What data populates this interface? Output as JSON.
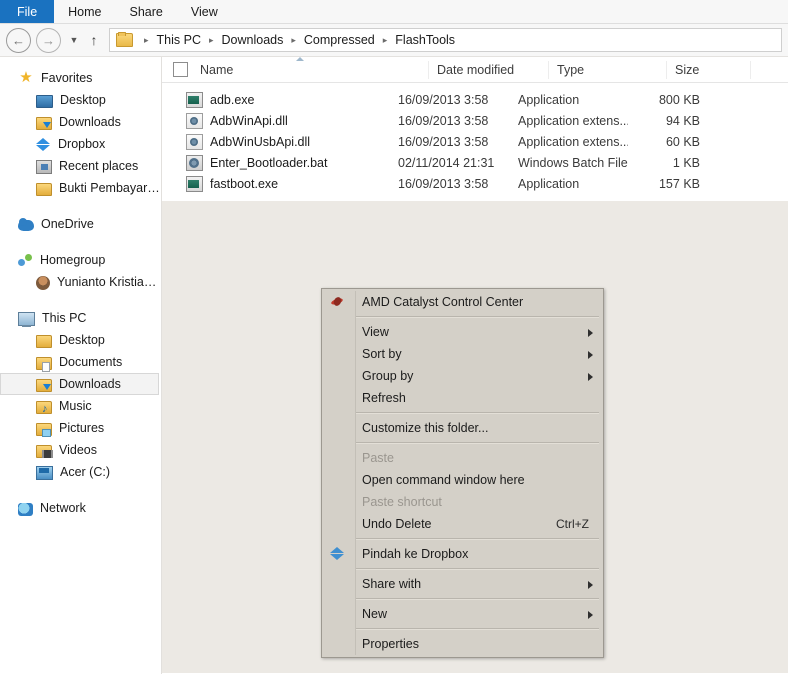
{
  "window": {
    "tabs": [
      {
        "label": "File",
        "active": true
      },
      {
        "label": "Home",
        "active": false
      },
      {
        "label": "Share",
        "active": false
      },
      {
        "label": "View",
        "active": false
      }
    ],
    "accent_color": "#1a72c0",
    "menu_bg_color": "#d4d0c8",
    "content_bg_color": "#ece9e4"
  },
  "nav": {
    "back_icon": "back-arrow-icon",
    "forward_icon": "forward-arrow-icon",
    "history_icon": "chevron-down-icon",
    "up_icon": "up-arrow-icon",
    "folder_icon": "folder-icon",
    "breadcrumbs": [
      "This PC",
      "Downloads",
      "Compressed",
      "FlashTools"
    ],
    "separator": "▸"
  },
  "sidebar": {
    "groups": [
      {
        "header": {
          "label": "Favorites",
          "icon": "star-icon"
        },
        "items": [
          {
            "label": "Desktop",
            "icon": "desktop-icon"
          },
          {
            "label": "Downloads",
            "icon": "downloads-folder-icon"
          },
          {
            "label": "Dropbox",
            "icon": "dropbox-icon"
          },
          {
            "label": "Recent places",
            "icon": "recent-places-icon"
          },
          {
            "label": "Bukti Pembayaran",
            "icon": "folder-icon"
          }
        ]
      },
      {
        "header": {
          "label": "OneDrive",
          "icon": "onedrive-cloud-icon"
        },
        "items": []
      },
      {
        "header": {
          "label": "Homegroup",
          "icon": "homegroup-icon"
        },
        "items": [
          {
            "label": "Yunianto Kristiawan",
            "icon": "user-avatar-icon"
          }
        ]
      },
      {
        "header": {
          "label": "This PC",
          "icon": "this-pc-icon"
        },
        "items": [
          {
            "label": "Desktop",
            "icon": "desktop-folder-icon"
          },
          {
            "label": "Documents",
            "icon": "documents-folder-icon"
          },
          {
            "label": "Downloads",
            "icon": "downloads-folder-icon",
            "selected": true
          },
          {
            "label": "Music",
            "icon": "music-folder-icon"
          },
          {
            "label": "Pictures",
            "icon": "pictures-folder-icon"
          },
          {
            "label": "Videos",
            "icon": "videos-folder-icon"
          },
          {
            "label": "Acer (C:)",
            "icon": "hard-drive-icon"
          }
        ]
      },
      {
        "header": {
          "label": "Network",
          "icon": "network-icon"
        },
        "items": []
      }
    ]
  },
  "filelist": {
    "select_all_checkbox": "select-all-checkbox",
    "sort_indicator": "sort-ascending-icon",
    "columns": [
      "Name",
      "Date modified",
      "Type",
      "Size"
    ],
    "rows": [
      {
        "name": "adb.exe",
        "icon": "exe-file-icon",
        "date": "16/09/2013 3:58",
        "type": "Application",
        "size": "800 KB"
      },
      {
        "name": "AdbWinApi.dll",
        "icon": "dll-file-icon",
        "date": "16/09/2013 3:58",
        "type": "Application extens...",
        "size": "94 KB"
      },
      {
        "name": "AdbWinUsbApi.dll",
        "icon": "dll-file-icon",
        "date": "16/09/2013 3:58",
        "type": "Application extens...",
        "size": "60 KB"
      },
      {
        "name": "Enter_Bootloader.bat",
        "icon": "bat-file-icon",
        "date": "02/11/2014 21:31",
        "type": "Windows Batch File",
        "size": "1 KB"
      },
      {
        "name": "fastboot.exe",
        "icon": "exe-file-icon",
        "date": "16/09/2013 3:58",
        "type": "Application",
        "size": "157 KB"
      }
    ]
  },
  "context_menu": {
    "items": [
      {
        "label": "AMD Catalyst Control Center",
        "icon": "amd-catalyst-icon",
        "submenu": false,
        "disabled": false,
        "accel": ""
      },
      {
        "separator": true
      },
      {
        "label": "View",
        "submenu": true,
        "disabled": false,
        "accel": ""
      },
      {
        "label": "Sort by",
        "submenu": true,
        "disabled": false,
        "accel": ""
      },
      {
        "label": "Group by",
        "submenu": true,
        "disabled": false,
        "accel": ""
      },
      {
        "label": "Refresh",
        "submenu": false,
        "disabled": false,
        "accel": ""
      },
      {
        "separator": true
      },
      {
        "label": "Customize this folder...",
        "submenu": false,
        "disabled": false,
        "accel": ""
      },
      {
        "separator": true
      },
      {
        "label": "Paste",
        "submenu": false,
        "disabled": true,
        "accel": ""
      },
      {
        "label": "Open command window here",
        "submenu": false,
        "disabled": false,
        "accel": ""
      },
      {
        "label": "Paste shortcut",
        "submenu": false,
        "disabled": true,
        "accel": ""
      },
      {
        "label": "Undo Delete",
        "submenu": false,
        "disabled": false,
        "accel": "Ctrl+Z"
      },
      {
        "separator": true
      },
      {
        "label": "Pindah ke Dropbox",
        "icon": "dropbox-icon",
        "submenu": false,
        "disabled": false,
        "accel": ""
      },
      {
        "separator": true
      },
      {
        "label": "Share with",
        "submenu": true,
        "disabled": false,
        "accel": ""
      },
      {
        "separator": true
      },
      {
        "label": "New",
        "submenu": true,
        "disabled": false,
        "accel": ""
      },
      {
        "separator": true
      },
      {
        "label": "Properties",
        "submenu": false,
        "disabled": false,
        "accel": ""
      }
    ]
  }
}
